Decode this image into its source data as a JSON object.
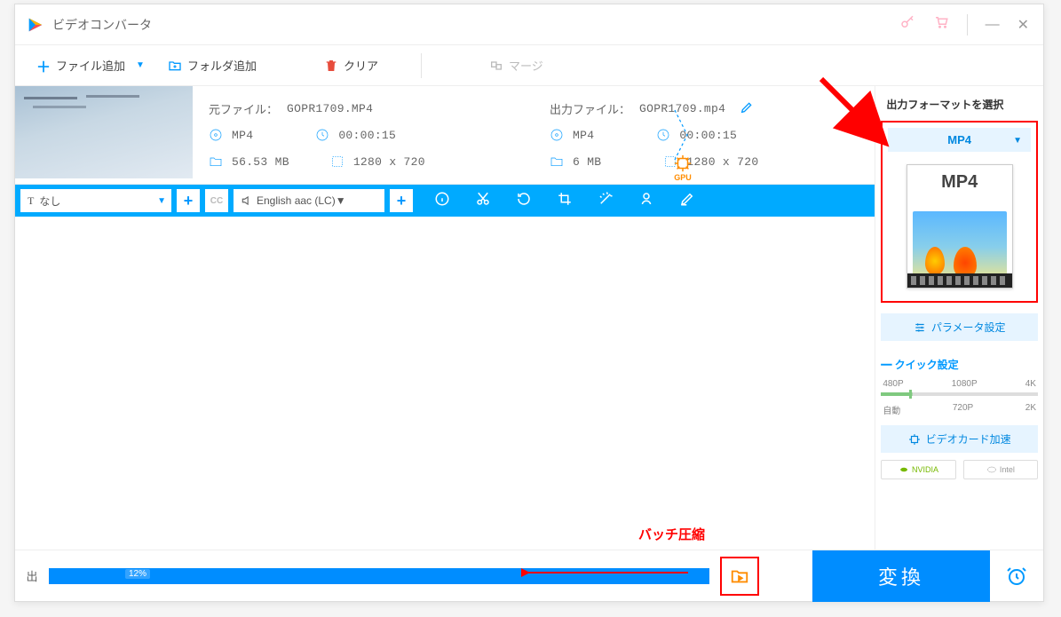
{
  "titlebar": {
    "title": "ビデオコンバータ"
  },
  "toolbar": {
    "add_file": "ファイル追加",
    "add_folder": "フォルダ追加",
    "clear": "クリア",
    "merge": "マージ"
  },
  "item": {
    "src_label": "元ファイル：",
    "src_name": "GOPR1709.MP4",
    "src_format": "MP4",
    "src_duration": "00:00:15",
    "src_size": "56.53 MB",
    "src_res": "1280 x 720",
    "gpu": "GPU",
    "out_label": "出力ファイル：",
    "out_name": "GOPR1709.mp4",
    "out_format": "MP4",
    "out_duration": "00:00:15",
    "out_size": "6 MB",
    "out_res": "1280 x 720"
  },
  "editbar": {
    "subtitle_prefix": "T",
    "subtitle_value": "なし",
    "cc": "CC",
    "audio_value": "English aac (LC)"
  },
  "sidebar": {
    "heading": "出力フォーマットを選択",
    "format": "MP4",
    "format_tile": "MP4",
    "param": "パラメータ設定",
    "quick": "クイック設定",
    "q": {
      "auto": "自動",
      "p480": "480P",
      "p720": "720P",
      "p1080": "1080P",
      "k2": "2K",
      "k4": "4K"
    },
    "gpu": "ビデオカード加速",
    "nvidia": "NVIDIA",
    "intel": "Intel"
  },
  "bottom": {
    "out_label": "出",
    "pct": "12%",
    "convert": "変換"
  },
  "annotations": {
    "batch": "バッチ圧縮"
  }
}
